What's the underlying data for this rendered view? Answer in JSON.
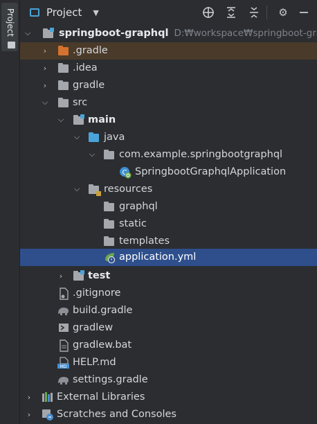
{
  "sidebar": {
    "project_tab_label": "Project"
  },
  "toolbar": {
    "title": "Project",
    "icons": [
      "locate-icon",
      "expand-all-icon",
      "collapse-all-icon",
      "gear-icon",
      "minimize-icon"
    ]
  },
  "tree": {
    "root": {
      "label": "springboot-graphql",
      "path": "D:₩workspace₩springboot-graphqlD:₩workspace₩springboot-graphql"
    },
    "items": [
      {
        "label": ".gradle"
      },
      {
        "label": ".idea"
      },
      {
        "label": "gradle"
      },
      {
        "label": "src"
      },
      {
        "label": "main"
      },
      {
        "label": "java"
      },
      {
        "label": "com.example.springbootgraphql"
      },
      {
        "label": "SpringbootGraphqlApplication"
      },
      {
        "label": "resources"
      },
      {
        "label": "graphql"
      },
      {
        "label": "static"
      },
      {
        "label": "templates"
      },
      {
        "label": "application.yml"
      },
      {
        "label": "test"
      },
      {
        "label": ".gitignore"
      },
      {
        "label": "build.gradle"
      },
      {
        "label": "gradlew"
      },
      {
        "label": "gradlew.bat"
      },
      {
        "label": "HELP.md"
      },
      {
        "label": "settings.gradle"
      },
      {
        "label": "External Libraries"
      },
      {
        "label": "Scratches and Consoles"
      }
    ]
  }
}
